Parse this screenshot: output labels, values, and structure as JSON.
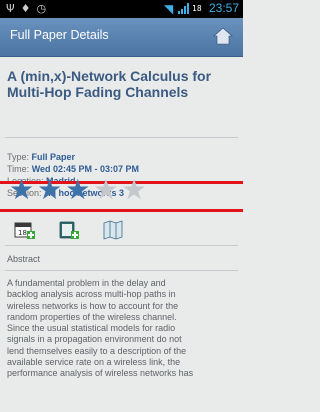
{
  "status_bar": {
    "time": "23:57",
    "battery": "18"
  },
  "action_bar": {
    "title": "Full Paper Details"
  },
  "paper": {
    "title": "A (min,x)-Network Calculus for Multi-Hop Fading Channels",
    "type_label": "Type:",
    "type_value": "Full Paper",
    "time_label": "Time:",
    "time_value": "Wed 02:45 PM - 03:07 PM",
    "location_label": "Location:",
    "location_value": "Madrid",
    "session_label": "Session:",
    "session_value": "Ad hoc networks 3"
  },
  "rating": {
    "filled": 3,
    "total": 5
  },
  "abstract": {
    "heading": "Abstract",
    "lines": [
      "A fundamental problem in the delay and",
      "backlog analysis across multi-hop paths in",
      "wireless networks is how to account for the",
      "random properties of the wireless channel.",
      "Since the usual statistical models for radio",
      "signals in a propagation environment do not",
      "lend themselves easily to a description of the",
      "available service rate on a wireless link, the",
      "performance analysis of wireless networks has"
    ]
  },
  "colors": {
    "accent": "#4b74a2",
    "title_text": "#3b5b82",
    "divider_red": "#e21419",
    "star_on": "#3e73a9",
    "star_off": "#c4c8cc"
  },
  "icons": [
    "calendar-add-icon",
    "note-add-icon",
    "map-icon",
    "home-icon"
  ]
}
